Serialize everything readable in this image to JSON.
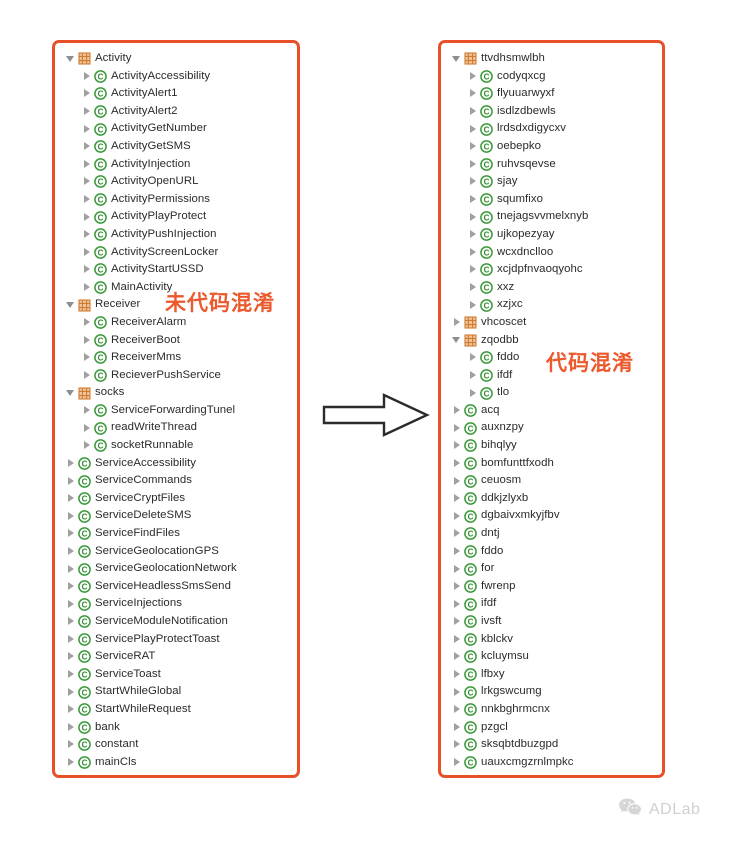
{
  "colors": {
    "panel_border": "#e8502a",
    "annotation": "#ea5a2d",
    "package_icon": "#e08a45",
    "class_icon": "#3a9b3a",
    "label_text": "#2b2b2b",
    "arrow_outline": "#2b2b2b",
    "watermark_text": "#8c8c8c"
  },
  "left_panel": {
    "annotation": "未代码混淆",
    "nodes": [
      {
        "label": "Activity",
        "level": 0,
        "icon": "package-icon",
        "state": "expanded"
      },
      {
        "label": "ActivityAccessibility",
        "level": 1,
        "icon": "class-icon",
        "state": "collapsed"
      },
      {
        "label": "ActivityAlert1",
        "level": 1,
        "icon": "class-icon",
        "state": "collapsed"
      },
      {
        "label": "ActivityAlert2",
        "level": 1,
        "icon": "class-icon",
        "state": "collapsed"
      },
      {
        "label": "ActivityGetNumber",
        "level": 1,
        "icon": "class-icon",
        "state": "collapsed"
      },
      {
        "label": "ActivityGetSMS",
        "level": 1,
        "icon": "class-icon",
        "state": "collapsed"
      },
      {
        "label": "ActivityInjection",
        "level": 1,
        "icon": "class-icon",
        "state": "collapsed"
      },
      {
        "label": "ActivityOpenURL",
        "level": 1,
        "icon": "class-icon",
        "state": "collapsed"
      },
      {
        "label": "ActivityPermissions",
        "level": 1,
        "icon": "class-icon",
        "state": "collapsed"
      },
      {
        "label": "ActivityPlayProtect",
        "level": 1,
        "icon": "class-icon",
        "state": "collapsed"
      },
      {
        "label": "ActivityPushInjection",
        "level": 1,
        "icon": "class-icon",
        "state": "collapsed"
      },
      {
        "label": "ActivityScreenLocker",
        "level": 1,
        "icon": "class-icon",
        "state": "collapsed"
      },
      {
        "label": "ActivityStartUSSD",
        "level": 1,
        "icon": "class-icon",
        "state": "collapsed"
      },
      {
        "label": "MainActivity",
        "level": 1,
        "icon": "class-icon",
        "state": "collapsed"
      },
      {
        "label": "Receiver",
        "level": 0,
        "icon": "package-icon",
        "state": "expanded"
      },
      {
        "label": "ReceiverAlarm",
        "level": 1,
        "icon": "class-icon",
        "state": "collapsed"
      },
      {
        "label": "ReceiverBoot",
        "level": 1,
        "icon": "class-icon",
        "state": "collapsed"
      },
      {
        "label": "ReceiverMms",
        "level": 1,
        "icon": "class-icon",
        "state": "collapsed"
      },
      {
        "label": "RecieverPushService",
        "level": 1,
        "icon": "class-icon",
        "state": "collapsed"
      },
      {
        "label": "socks",
        "level": 0,
        "icon": "package-icon",
        "state": "expanded"
      },
      {
        "label": "ServiceForwardingTunel",
        "level": 1,
        "icon": "class-icon",
        "state": "collapsed"
      },
      {
        "label": "readWriteThread",
        "level": 1,
        "icon": "class-icon",
        "state": "collapsed"
      },
      {
        "label": "socketRunnable",
        "level": 1,
        "icon": "class-icon",
        "state": "collapsed"
      },
      {
        "label": "ServiceAccessibility",
        "level": 0,
        "icon": "class-icon",
        "state": "collapsed"
      },
      {
        "label": "ServiceCommands",
        "level": 0,
        "icon": "class-icon",
        "state": "collapsed"
      },
      {
        "label": "ServiceCryptFiles",
        "level": 0,
        "icon": "class-icon",
        "state": "collapsed"
      },
      {
        "label": "ServiceDeleteSMS",
        "level": 0,
        "icon": "class-icon",
        "state": "collapsed"
      },
      {
        "label": "ServiceFindFiles",
        "level": 0,
        "icon": "class-icon",
        "state": "collapsed"
      },
      {
        "label": "ServiceGeolocationGPS",
        "level": 0,
        "icon": "class-icon",
        "state": "collapsed"
      },
      {
        "label": "ServiceGeolocationNetwork",
        "level": 0,
        "icon": "class-icon",
        "state": "collapsed"
      },
      {
        "label": "ServiceHeadlessSmsSend",
        "level": 0,
        "icon": "class-icon",
        "state": "collapsed"
      },
      {
        "label": "ServiceInjections",
        "level": 0,
        "icon": "class-icon",
        "state": "collapsed"
      },
      {
        "label": "ServiceModuleNotification",
        "level": 0,
        "icon": "class-icon",
        "state": "collapsed"
      },
      {
        "label": "ServicePlayProtectToast",
        "level": 0,
        "icon": "class-icon",
        "state": "collapsed"
      },
      {
        "label": "ServiceRAT",
        "level": 0,
        "icon": "class-icon",
        "state": "collapsed"
      },
      {
        "label": "ServiceToast",
        "level": 0,
        "icon": "class-icon",
        "state": "collapsed"
      },
      {
        "label": "StartWhileGlobal",
        "level": 0,
        "icon": "class-icon",
        "state": "collapsed"
      },
      {
        "label": "StartWhileRequest",
        "level": 0,
        "icon": "class-icon",
        "state": "collapsed"
      },
      {
        "label": "bank",
        "level": 0,
        "icon": "class-icon",
        "state": "collapsed"
      },
      {
        "label": "constant",
        "level": 0,
        "icon": "class-icon",
        "state": "collapsed"
      },
      {
        "label": "mainCls",
        "level": 0,
        "icon": "class-icon",
        "state": "collapsed"
      }
    ]
  },
  "right_panel": {
    "annotation": "代码混淆",
    "nodes": [
      {
        "label": "ttvdhsmwlbh",
        "level": 0,
        "icon": "package-icon",
        "state": "expanded"
      },
      {
        "label": "codyqxcg",
        "level": 1,
        "icon": "class-icon",
        "state": "collapsed"
      },
      {
        "label": "flyuuarwyxf",
        "level": 1,
        "icon": "class-icon",
        "state": "collapsed"
      },
      {
        "label": "isdlzdbewls",
        "level": 1,
        "icon": "class-icon",
        "state": "collapsed"
      },
      {
        "label": "lrdsdxdigycxv",
        "level": 1,
        "icon": "class-icon",
        "state": "collapsed"
      },
      {
        "label": "oebepko",
        "level": 1,
        "icon": "class-icon",
        "state": "collapsed"
      },
      {
        "label": "ruhvsqevse",
        "level": 1,
        "icon": "class-icon",
        "state": "collapsed"
      },
      {
        "label": "sjay",
        "level": 1,
        "icon": "class-icon",
        "state": "collapsed"
      },
      {
        "label": "squmfixo",
        "level": 1,
        "icon": "class-icon",
        "state": "collapsed"
      },
      {
        "label": "tnejagsvvmelxnyb",
        "level": 1,
        "icon": "class-icon",
        "state": "collapsed"
      },
      {
        "label": "ujkopezyay",
        "level": 1,
        "icon": "class-icon",
        "state": "collapsed"
      },
      {
        "label": "wcxdnclloo",
        "level": 1,
        "icon": "class-icon",
        "state": "collapsed"
      },
      {
        "label": "xcjdpfnvaoqyohc",
        "level": 1,
        "icon": "class-icon",
        "state": "collapsed"
      },
      {
        "label": "xxz",
        "level": 1,
        "icon": "class-icon",
        "state": "collapsed"
      },
      {
        "label": "xzjxc",
        "level": 1,
        "icon": "class-icon",
        "state": "collapsed"
      },
      {
        "label": "vhcoscet",
        "level": 0,
        "icon": "package-icon",
        "state": "collapsed"
      },
      {
        "label": "zqodbb",
        "level": 0,
        "icon": "package-icon",
        "state": "expanded"
      },
      {
        "label": "fddo",
        "level": 1,
        "icon": "class-icon",
        "state": "collapsed"
      },
      {
        "label": "ifdf",
        "level": 1,
        "icon": "class-icon",
        "state": "collapsed"
      },
      {
        "label": "tlo",
        "level": 1,
        "icon": "class-icon",
        "state": "collapsed"
      },
      {
        "label": "acq",
        "level": 0,
        "icon": "class-icon",
        "state": "collapsed"
      },
      {
        "label": "auxnzpy",
        "level": 0,
        "icon": "class-icon",
        "state": "collapsed"
      },
      {
        "label": "bihqlyy",
        "level": 0,
        "icon": "class-icon",
        "state": "collapsed"
      },
      {
        "label": "bomfunttfxodh",
        "level": 0,
        "icon": "class-icon",
        "state": "collapsed"
      },
      {
        "label": "ceuosm",
        "level": 0,
        "icon": "class-icon",
        "state": "collapsed"
      },
      {
        "label": "ddkjzlyxb",
        "level": 0,
        "icon": "class-icon",
        "state": "collapsed"
      },
      {
        "label": "dgbaivxmkyjfbv",
        "level": 0,
        "icon": "class-icon",
        "state": "collapsed"
      },
      {
        "label": "dntj",
        "level": 0,
        "icon": "class-icon",
        "state": "collapsed"
      },
      {
        "label": "fddo",
        "level": 0,
        "icon": "class-icon",
        "state": "collapsed"
      },
      {
        "label": "for",
        "level": 0,
        "icon": "class-icon",
        "state": "collapsed"
      },
      {
        "label": "fwrenp",
        "level": 0,
        "icon": "class-icon",
        "state": "collapsed"
      },
      {
        "label": "ifdf",
        "level": 0,
        "icon": "class-icon",
        "state": "collapsed"
      },
      {
        "label": "ivsft",
        "level": 0,
        "icon": "class-icon",
        "state": "collapsed"
      },
      {
        "label": "kblckv",
        "level": 0,
        "icon": "class-icon",
        "state": "collapsed"
      },
      {
        "label": "kcluymsu",
        "level": 0,
        "icon": "class-icon",
        "state": "collapsed"
      },
      {
        "label": "lfbxy",
        "level": 0,
        "icon": "class-icon",
        "state": "collapsed"
      },
      {
        "label": "lrkgswcumg",
        "level": 0,
        "icon": "class-icon",
        "state": "collapsed"
      },
      {
        "label": "nnkbghrmcnx",
        "level": 0,
        "icon": "class-icon",
        "state": "collapsed"
      },
      {
        "label": "pzgcl",
        "level": 0,
        "icon": "class-icon",
        "state": "collapsed"
      },
      {
        "label": "sksqbtdbuzgpd",
        "level": 0,
        "icon": "class-icon",
        "state": "collapsed"
      },
      {
        "label": "uauxcmgzrnlmpkc",
        "level": 0,
        "icon": "class-icon",
        "state": "collapsed"
      }
    ]
  },
  "arrow": {
    "icon": "right-arrow-icon"
  },
  "watermark": {
    "icon": "wechat-icon",
    "text": "ADLab"
  }
}
